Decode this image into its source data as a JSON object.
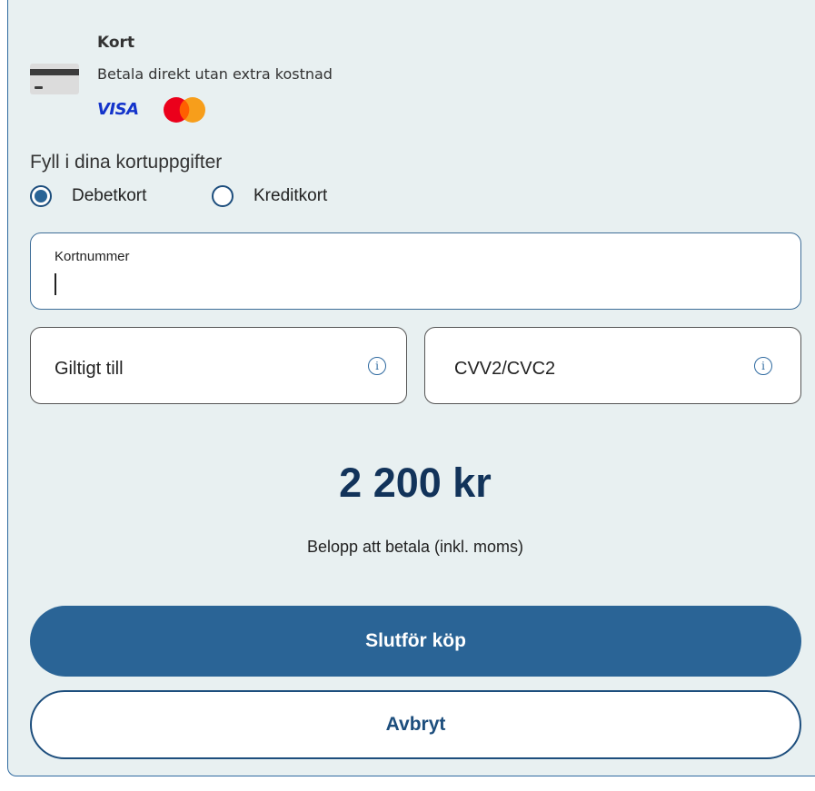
{
  "payment_method": {
    "title": "Kort",
    "subtitle": "Betala direkt utan extra kostnad",
    "brands": {
      "visa": "VISA",
      "mastercard_colors": [
        "#eb001b",
        "#f79e1b"
      ]
    },
    "icon": "credit-card-icon"
  },
  "form": {
    "heading": "Fyll i dina kortuppgifter",
    "card_types": [
      {
        "label": "Debetkort",
        "selected": true
      },
      {
        "label": "Kreditkort",
        "selected": false
      }
    ],
    "card_number": {
      "label": "Kortnummer",
      "value": ""
    },
    "expiry": {
      "placeholder": "Giltigt till"
    },
    "cvv": {
      "placeholder": "CVV2/CVC2"
    }
  },
  "summary": {
    "amount": "2 200 kr",
    "amount_label": "Belopp att betala (inkl. moms)"
  },
  "actions": {
    "submit_label": "Slutför köp",
    "cancel_label": "Avbryt"
  },
  "colors": {
    "primary": "#2a6496",
    "panel_bg": "#e8f0f1",
    "amount": "#12335a"
  }
}
